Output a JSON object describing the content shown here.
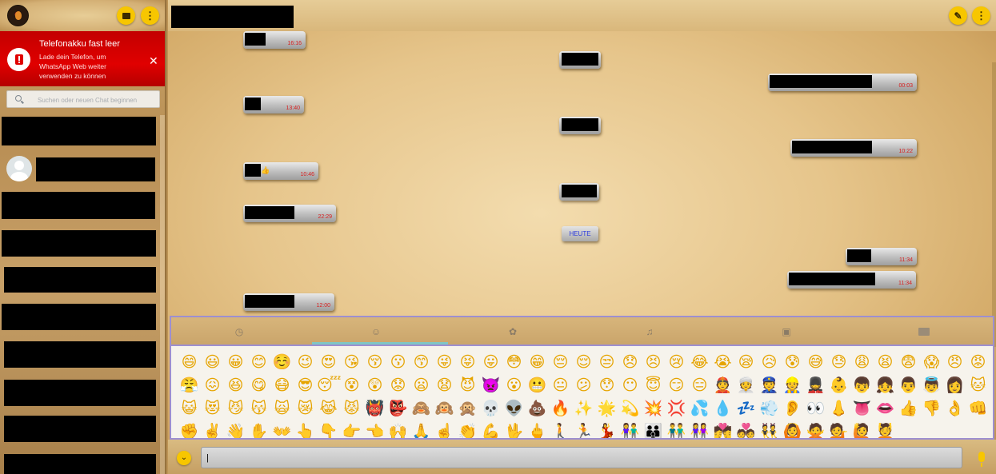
{
  "sidebar": {
    "alert": {
      "title": "Telefonakku fast leer",
      "body": "Lade dein Telefon, um WhatsApp Web weiter verwenden zu können",
      "close": "✕"
    },
    "search": {
      "placeholder": "Suchen oder neuen Chat beginnen"
    },
    "icons": {
      "chat": "chat-icon",
      "menu": "menu-icon"
    }
  },
  "conversation": {
    "messages_left": [
      {
        "time": "16:16"
      },
      {
        "time": "13:40"
      },
      {
        "time": "10:46",
        "emoji": "👍"
      },
      {
        "time": "22:29"
      },
      {
        "time": "12:00"
      }
    ],
    "messages_right": [
      {
        "time": "00:03"
      },
      {
        "time": "10:22"
      },
      {
        "time": "11:34"
      },
      {
        "time": "11:34"
      }
    ],
    "date_label": "HEUTE"
  },
  "emoji_panel": {
    "tabs": [
      "recent",
      "smileys",
      "nature",
      "objects",
      "travel",
      "symbols"
    ],
    "active_tab": "smileys",
    "emojis": [
      "😄",
      "😃",
      "😀",
      "😊",
      "☺️",
      "😉",
      "😍",
      "😘",
      "😚",
      "😗",
      "😙",
      "😜",
      "😝",
      "😛",
      "😳",
      "😁",
      "😔",
      "😌",
      "😒",
      "😞",
      "😣",
      "😢",
      "😂",
      "😭",
      "😪",
      "😥",
      "😰",
      "😅",
      "😓",
      "😩",
      "😫",
      "😨",
      "😱",
      "😠",
      "😡",
      "😤",
      "😖",
      "😆",
      "😋",
      "😷",
      "😎",
      "😴",
      "😵",
      "😲",
      "😟",
      "😦",
      "😧",
      "😈",
      "👿",
      "😮",
      "😬",
      "😐",
      "😕",
      "😯",
      "😶",
      "😇",
      "😏",
      "😑",
      "👲",
      "👳",
      "👮",
      "👷",
      "💂",
      "👶",
      "👦",
      "👧",
      "👨",
      "👼",
      "👩",
      "🐱",
      "😺",
      "😻",
      "😼",
      "😽",
      "🙀",
      "😿",
      "😹",
      "😾",
      "👹",
      "👺",
      "🙈",
      "🙉",
      "🙊",
      "💀",
      "👽",
      "💩",
      "🔥",
      "✨",
      "🌟",
      "💫",
      "💥",
      "💢",
      "💦",
      "💧",
      "💤",
      "💨",
      "👂",
      "👀",
      "👃",
      "👅",
      "👄",
      "👍",
      "👎",
      "👌",
      "👊",
      "✊",
      "✌️",
      "👋",
      "✋",
      "👐",
      "👆",
      "👇",
      "👉",
      "👈",
      "🙌",
      "🙏",
      "☝️",
      "👏",
      "💪",
      "🖖",
      "🖕",
      "🚶",
      "🏃",
      "💃",
      "👫",
      "👪",
      "👬",
      "👭",
      "💏",
      "💑",
      "👯",
      "🙆",
      "🙅",
      "💁",
      "🙋",
      "💆"
    ]
  },
  "compose": {
    "value": "|"
  },
  "colors": {
    "accent_yellow": "#f7c600",
    "alert_red": "#e00000",
    "time_red": "#d81f1f",
    "date_blue": "#2d3cdc"
  }
}
